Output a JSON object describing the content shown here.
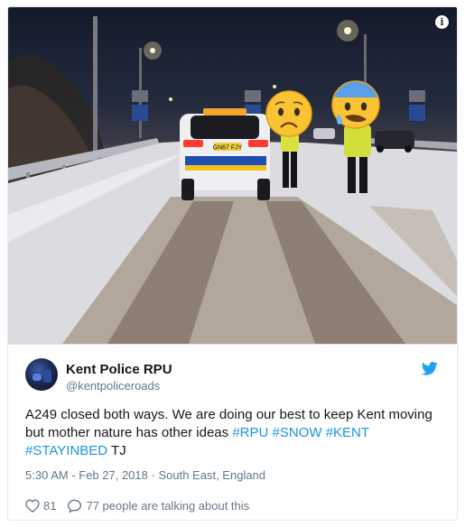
{
  "photo": {
    "plate": "GN67 FJY",
    "info_icon": "info-icon"
  },
  "tweet": {
    "author_name": "Kent Police RPU",
    "author_handle": "@kentpoliceroads",
    "text": "A249 closed both ways. We are doing our best to keep Kent moving but mother nature has other ideas ",
    "hashtags": [
      "#RPU",
      "#SNOW",
      "#KENT",
      "#STAYINBED"
    ],
    "signoff": "TJ",
    "time": "5:30 AM - Feb 27, 2018",
    "separator": "·",
    "location": "South East, England",
    "likes": "81",
    "talking": "77 people are talking about this"
  },
  "colors": {
    "link": "#1b95e0",
    "twitter_blue": "#1da1f2",
    "muted": "#657786"
  }
}
